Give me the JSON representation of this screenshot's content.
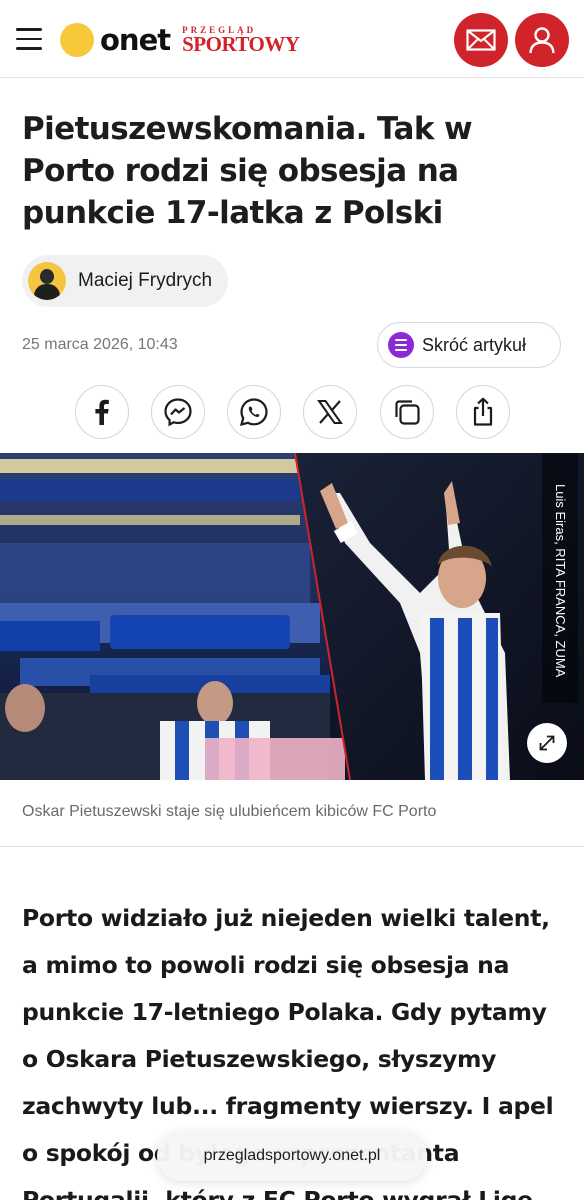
{
  "header": {
    "logo_text": "onet",
    "brand_top": "PRZEGLĄD",
    "brand_bottom": "SPORTOWY",
    "menu_icon": "hamburger-icon",
    "mail_icon": "mail-icon",
    "user_icon": "user-icon",
    "accent_color": "#d1232a"
  },
  "article": {
    "title": "Pietuszewskomania. Tak w Porto rodzi się obsesja na punkcie 17-latka z Polski",
    "author": "Maciej Frydrych",
    "date": "25 marca 2026, 10:43",
    "summarize_label": "Skróć artykuł",
    "share_icons": [
      "facebook-icon",
      "messenger-icon",
      "whatsapp-icon",
      "x-icon",
      "copy-icon",
      "share-icon"
    ],
    "image_credit": "Luis Eiras, RITA FRANCA, ZUMA",
    "caption": "Oskar Pietuszewski staje się ulubieńcem kibiców FC Porto",
    "lead": "Porto widziało już niejeden wielki talent, a mimo to powoli rodzi się obsesja na punkcie 17-letniego Polaka. Gdy pytamy o Oskara Pietuszewskiego, słyszymy zachwyty lub... fragmenty wierszy. I apel o spokój od byłego reprezentanta Portugalii, który z FC Porto wygrał Ligę"
  },
  "browser": {
    "url": "przegladsportowy.onet.pl"
  }
}
